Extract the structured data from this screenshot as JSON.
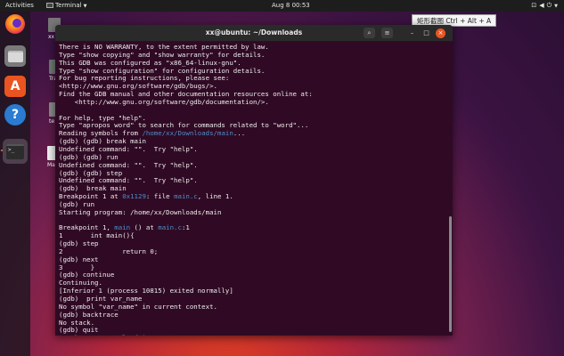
{
  "topbar": {
    "activities": "Activities",
    "app_menu": "Terminal",
    "clock": "Aug 8  00:53"
  },
  "dock": {
    "items": [
      "firefox-icon",
      "files-icon",
      "software-center-icon",
      "help-icon",
      "terminal-icon"
    ]
  },
  "desktop": {
    "icons": [
      {
        "label": "xx",
        "icon": "home-folder-icon"
      },
      {
        "label": "Tra",
        "icon": "trash-icon"
      },
      {
        "label": "te",
        "icon": "folder-icon"
      },
      {
        "label": "Make",
        "icon": "file-icon"
      }
    ]
  },
  "hint": {
    "text": "矩形截图 Ctrl + Alt + A"
  },
  "window": {
    "title": "xx@ubuntu: ~/Downloads"
  },
  "terminal": {
    "lines": [
      "There is NO WARRANTY, to the extent permitted by law.",
      "Type \"show copying\" and \"show warranty\" for details.",
      "This GDB was configured as \"x86_64-linux-gnu\".",
      "Type \"show configuration\" for configuration details.",
      "For bug reporting instructions, please see:",
      "<http://www.gnu.org/software/gdb/bugs/>.",
      "Find the GDB manual and other documentation resources online at:",
      "    <http://www.gnu.org/software/gdb/documentation/>.",
      "",
      "For help, type \"help\".",
      "Type \"apropos word\" to search for commands related to \"word\"...",
      "Reading symbols from /home/xx/Downloads/main...",
      "(gdb) (gdb) break main",
      "Undefined command: \"\".  Try \"help\".",
      "(gdb) (gdb) run",
      "Undefined command: \"\".  Try \"help\".",
      "(gdb) (gdb) step",
      "Undefined command: \"\".  Try \"help\".",
      "(gdb)  break main",
      "Breakpoint 1 at 0x1129: file main.c, line 1.",
      "(gdb) run",
      "Starting program: /home/xx/Downloads/main",
      "",
      "Breakpoint 1, main () at main.c:1",
      "1       int main(){",
      "(gdb) step",
      "2               return 0;",
      "(gdb) next",
      "3       }",
      "(gdb) continue",
      "Continuing.",
      "[Inferior 1 (process 10815) exited normally]",
      "(gdb)  print var_name",
      "No symbol \"var_name\" in current context.",
      "(gdb) backtrace",
      "No stack.",
      "(gdb) quit"
    ],
    "highlights": {
      "symbols_path": "/home/xx/Downloads/main",
      "address": "0x1129",
      "file": "main.c",
      "func": "main",
      "file_line": "main.c"
    },
    "prompt": {
      "user": "xx@ubuntu",
      "path": ":~/Downloads",
      "symbol": "$"
    }
  }
}
